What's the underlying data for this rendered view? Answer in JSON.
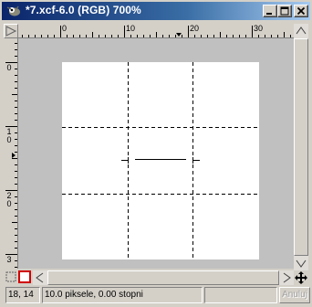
{
  "window": {
    "title": "*7.xcf-6.0 (RGB) 700%",
    "icon": "gimp-wilber-icon"
  },
  "ruler": {
    "horizontal_labels": [
      "0",
      "10",
      "20",
      "30"
    ],
    "vertical_labels": [
      "0",
      "1 0",
      "2 0",
      "3"
    ]
  },
  "status": {
    "coords": "18, 14",
    "info": "10.0 piksele, 0.00 stopni",
    "progress": ""
  },
  "buttons": {
    "cancel_label": "Anuluj"
  }
}
